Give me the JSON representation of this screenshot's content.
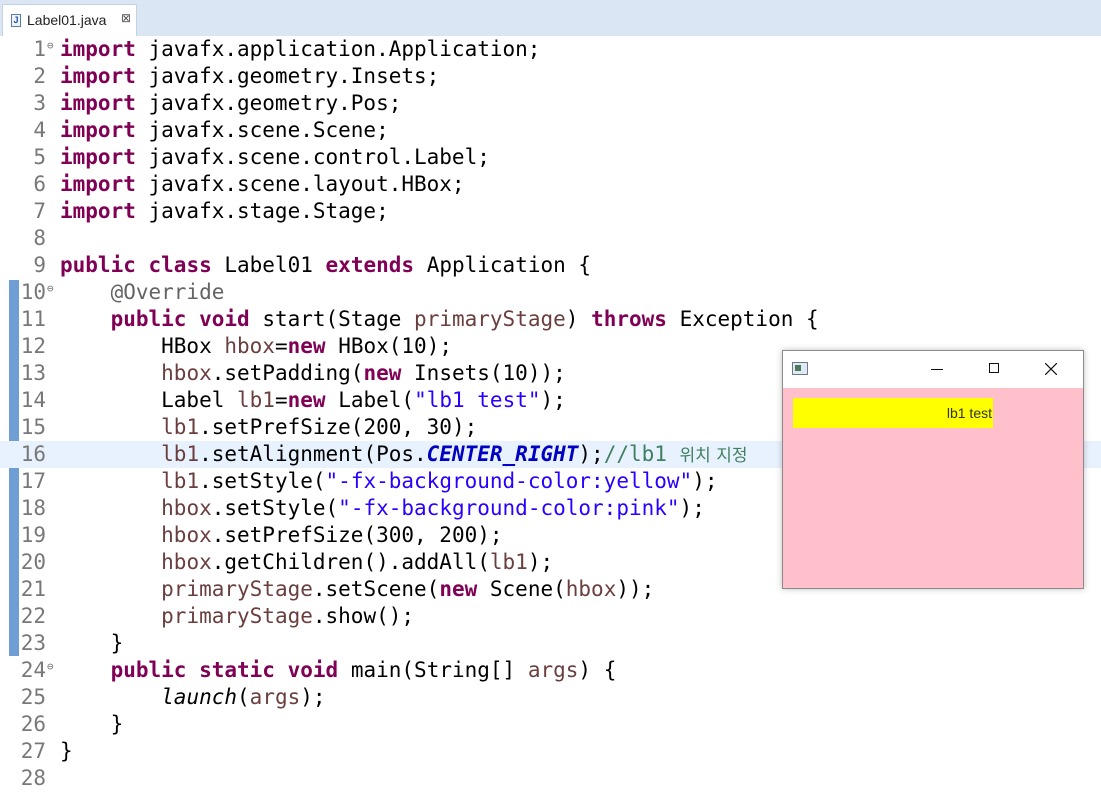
{
  "tab": {
    "title": "Label01.java",
    "close_glyph": "⊠",
    "icon": "java-file-icon"
  },
  "code_lines": [
    {
      "n": "1",
      "fold": "⊖",
      "html": "<span class=\"kw\">import</span> javafx.application.Application;"
    },
    {
      "n": "2",
      "html": "<span class=\"kw\">import</span> javafx.geometry.Insets;"
    },
    {
      "n": "3",
      "html": "<span class=\"kw\">import</span> javafx.geometry.Pos;"
    },
    {
      "n": "4",
      "html": "<span class=\"kw\">import</span> javafx.scene.Scene;"
    },
    {
      "n": "5",
      "html": "<span class=\"kw\">import</span> javafx.scene.control.Label;"
    },
    {
      "n": "6",
      "html": "<span class=\"kw\">import</span> javafx.scene.layout.HBox;"
    },
    {
      "n": "7",
      "html": "<span class=\"kw\">import</span> javafx.stage.Stage;"
    },
    {
      "n": "8",
      "html": ""
    },
    {
      "n": "9",
      "html": "<span class=\"kw\">public</span> <span class=\"kw\">class</span> Label01 <span class=\"kw\">extends</span> Application {"
    },
    {
      "n": "10",
      "fold": "⊖",
      "html": "    <span class=\"ann\">@Override</span>"
    },
    {
      "n": "11",
      "html": "    <span class=\"kw\">public</span> <span class=\"kw\">void</span> start(Stage <span class=\"var\">primaryStage</span>) <span class=\"kw\">throws</span> Exception {"
    },
    {
      "n": "12",
      "html": "        HBox <span class=\"var\">hbox</span>=<span class=\"kw\">new</span> HBox(10);"
    },
    {
      "n": "13",
      "html": "        <span class=\"var\">hbox</span>.setPadding(<span class=\"kw\">new</span> Insets(10));"
    },
    {
      "n": "14",
      "html": "        Label <span class=\"var\">lb1</span>=<span class=\"kw\">new</span> Label(<span class=\"str\">\"lb1 test\"</span>);"
    },
    {
      "n": "15",
      "html": "        <span class=\"var\">lb1</span>.setPrefSize(200, 30);"
    },
    {
      "n": "16",
      "current": true,
      "html": "        <span class=\"var\">lb1</span>.setAlignment(Pos.<span class=\"fld\">CENTER_RIGHT</span>);<span class=\"cmt\">//lb1 <span class=\"ko\">위치 지정</span></span>"
    },
    {
      "n": "17",
      "html": "        <span class=\"var\">lb1</span>.setStyle(<span class=\"str\">\"-fx-background-color:yellow\"</span>);"
    },
    {
      "n": "18",
      "html": "        <span class=\"var\">hbox</span>.setStyle(<span class=\"str\">\"-fx-background-color:pink\"</span>);"
    },
    {
      "n": "19",
      "html": "        <span class=\"var\">hbox</span>.setPrefSize(300, 200);"
    },
    {
      "n": "20",
      "html": "        <span class=\"var\">hbox</span>.getChildren().addAll(<span class=\"var\">lb1</span>);"
    },
    {
      "n": "21",
      "html": "        <span class=\"var\">primaryStage</span>.setScene(<span class=\"kw\">new</span> Scene(<span class=\"var\">hbox</span>));"
    },
    {
      "n": "22",
      "html": "        <span class=\"var\">primaryStage</span>.show();"
    },
    {
      "n": "23",
      "html": "    }"
    },
    {
      "n": "24",
      "fold": "⊖",
      "html": "    <span class=\"kw\">public</span> <span class=\"kw\">static</span> <span class=\"kw\">void</span> main(String[] <span class=\"var\">args</span>) {"
    },
    {
      "n": "25",
      "html": "        <span class=\"ital\">launch</span>(<span class=\"var\">args</span>);"
    },
    {
      "n": "26",
      "html": "    }"
    },
    {
      "n": "27",
      "html": "}"
    },
    {
      "n": "28",
      "html": ""
    }
  ],
  "fx_window": {
    "label_text": "lb1 test",
    "colors": {
      "content_bg": "#ffc0cb",
      "label_bg": "#ffff00"
    },
    "buttons": [
      "minimize-icon",
      "maximize-icon",
      "close-icon"
    ]
  }
}
